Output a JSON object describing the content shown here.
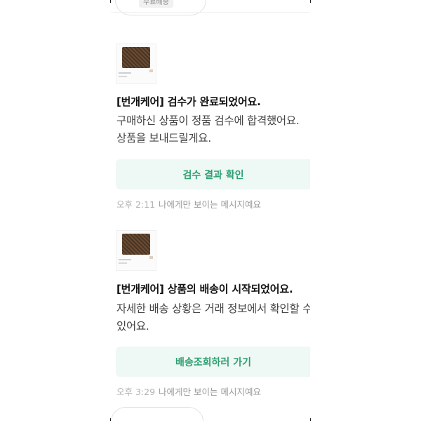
{
  "top": {
    "badge": "무료배송"
  },
  "messages": [
    {
      "title": "[번개케어] 검수가 완료되었어요.",
      "body_lines": [
        "구매하신 상품이 정품 검수에 합격했어요.",
        "상품을 보내드릴게요."
      ],
      "button": "검수 결과 확인",
      "time": "오후 2:11",
      "note": "나에게만 보이는 메시지예요"
    },
    {
      "title": "[번개케어] 상품의 배송이 시작되었어요.",
      "body_lines": [
        "자세한 배송 상황은 거래 정보에서 확인할 수",
        "있어요."
      ],
      "button": "배송조회하러 가기",
      "time": "오후 3:29",
      "note": "나에게만 보이는 메시지예요"
    }
  ],
  "colors": {
    "button_bg": "#eef8f4",
    "button_text": "#2e9f72",
    "meta_text": "#9a9a9a"
  }
}
